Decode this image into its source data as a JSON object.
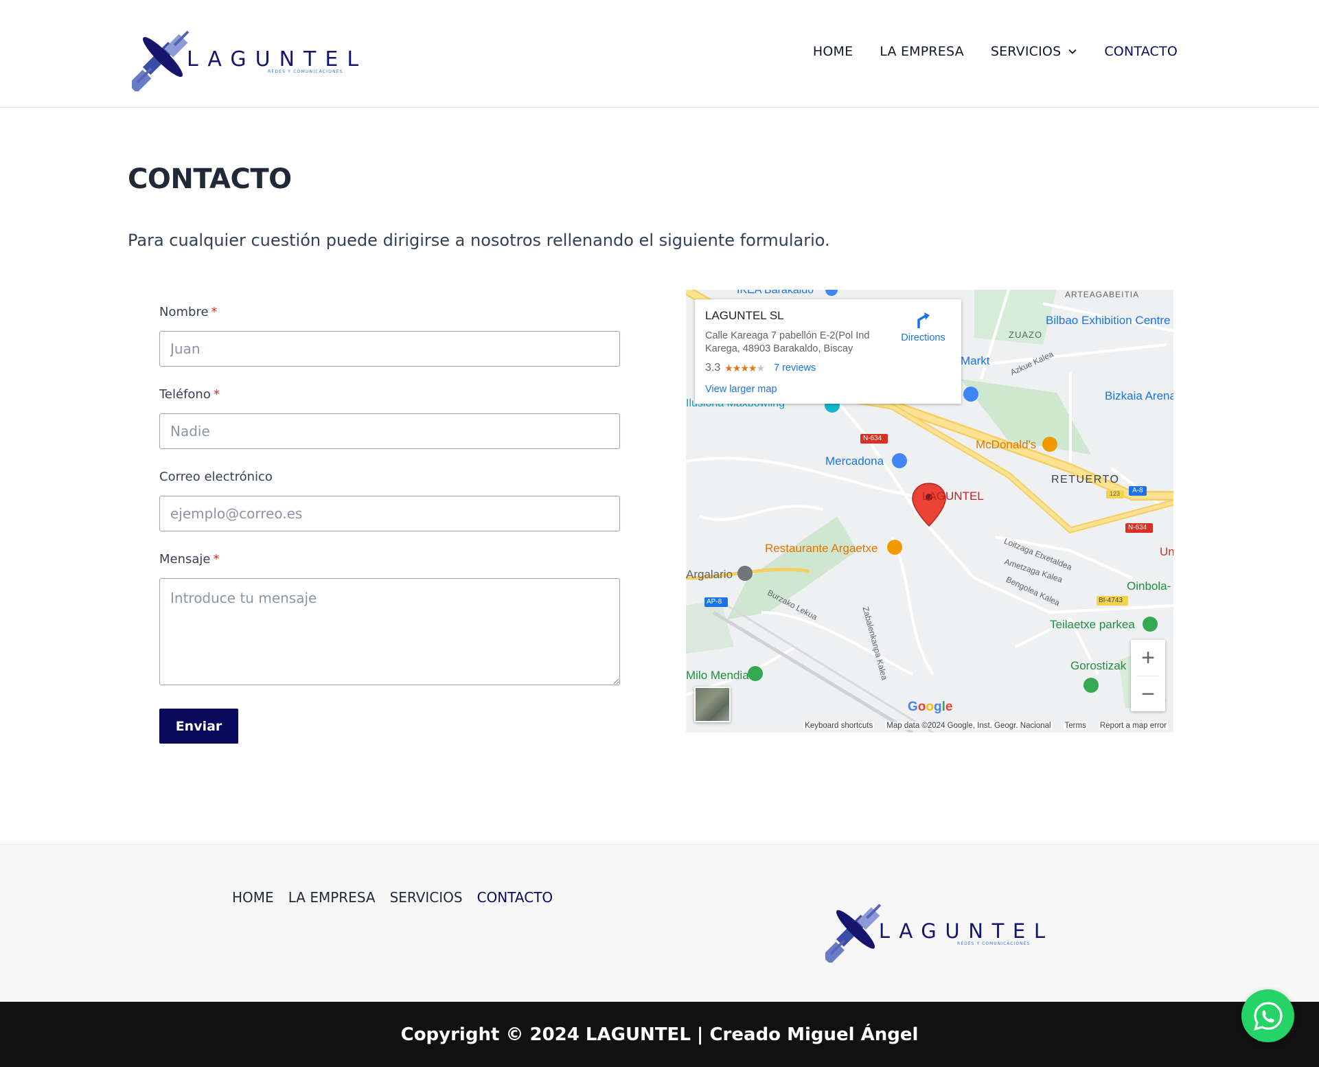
{
  "header": {
    "logo_text": "LAGUNTEL",
    "logo_tagline": "REDES Y COMUNICACIONES",
    "nav": [
      {
        "label": "HOME"
      },
      {
        "label": "LA EMPRESA"
      },
      {
        "label": "SERVICIOS"
      },
      {
        "label": "CONTACTO"
      }
    ]
  },
  "page": {
    "title": "CONTACTO",
    "intro": "Para cualquier cuestión puede dirigirse a nosotros rellenando el siguiente formulario."
  },
  "form": {
    "required_marker": "*",
    "name": {
      "label": "Nombre",
      "placeholder": "Juan"
    },
    "phone": {
      "label": "Teléfono",
      "placeholder": "Nadie"
    },
    "email": {
      "label": "Correo electrónico",
      "placeholder": "ejemplo@correo.es"
    },
    "message": {
      "label": "Mensaje",
      "placeholder": "Introduce tu mensaje"
    },
    "submit_label": "Enviar"
  },
  "map": {
    "place_name": "LAGUNTEL SL",
    "address": "Calle Kareaga 7 pabellón E-2(Pol Ind Karega, 48903 Barakaldo, Biscay",
    "rating": "3.3",
    "rating_value": 3.3,
    "reviews": "7 reviews",
    "directions_label": "Directions",
    "view_larger": "View larger map",
    "marker_label": "LAGUNTEL",
    "zoom_in": "+",
    "zoom_out": "−",
    "google": "Google",
    "footer": {
      "shortcuts": "Keyboard shortcuts",
      "data": "Map data ©2024 Google, Inst. Geogr. Nacional",
      "terms": "Terms",
      "report": "Report a map error"
    },
    "labels": {
      "ikea": "IKEA Barakaldo",
      "arteagabeitia": "ARTEAGABEITIA",
      "bec": "Bilbao Exhibition Centre",
      "zuazo": "ZUAZO",
      "markt": "Markt",
      "azkue": "Azkue Kalea",
      "bizkaia": "Bizkaia Arena",
      "ilusiona": "Ilusiona Maxbowling",
      "n634a": "N-634",
      "mcdonalds": "McDonald's",
      "mercadona": "Mercadona",
      "retuerto": "RETUERTO",
      "a8a": "A-8",
      "r123": "123",
      "n634b": "N-634",
      "un": "Un",
      "restaurante": "Restaurante Argaetxe",
      "loitzaga": "Loitzaga Etxetaldea",
      "ametzaga": "Ametzaga Kalea",
      "bengolea": "Bengolea Kalea",
      "oinbola": "Oinbola-",
      "argalario": "Argalario",
      "ap8": "AP-8",
      "burzako": "Burzako Lekua",
      "bi4743": "BI-4743",
      "zabalenkanpa": "Zabalenkanpa Kalea",
      "teilaetxe": "Teilaetxe parkea",
      "gorostizak": "Gorostizak",
      "milo": "Milo Mendia"
    }
  },
  "footer": {
    "nav": [
      {
        "label": "HOME"
      },
      {
        "label": "LA EMPRESA"
      },
      {
        "label": "SERVICIOS"
      },
      {
        "label": "CONTACTO"
      }
    ],
    "copyright": "Copyright © 2024 LAGUNTEL | Creado Miguel Ángel"
  },
  "colors": {
    "brand_navy": "#0a0a5c",
    "whatsapp_green": "#25d366",
    "required_red": "#dc2626",
    "footer_dark": "#111111"
  },
  "icons": [
    "satellite-logo-icon",
    "chevron-down-icon",
    "directions-icon",
    "map-pin-icon",
    "whatsapp-icon"
  ]
}
